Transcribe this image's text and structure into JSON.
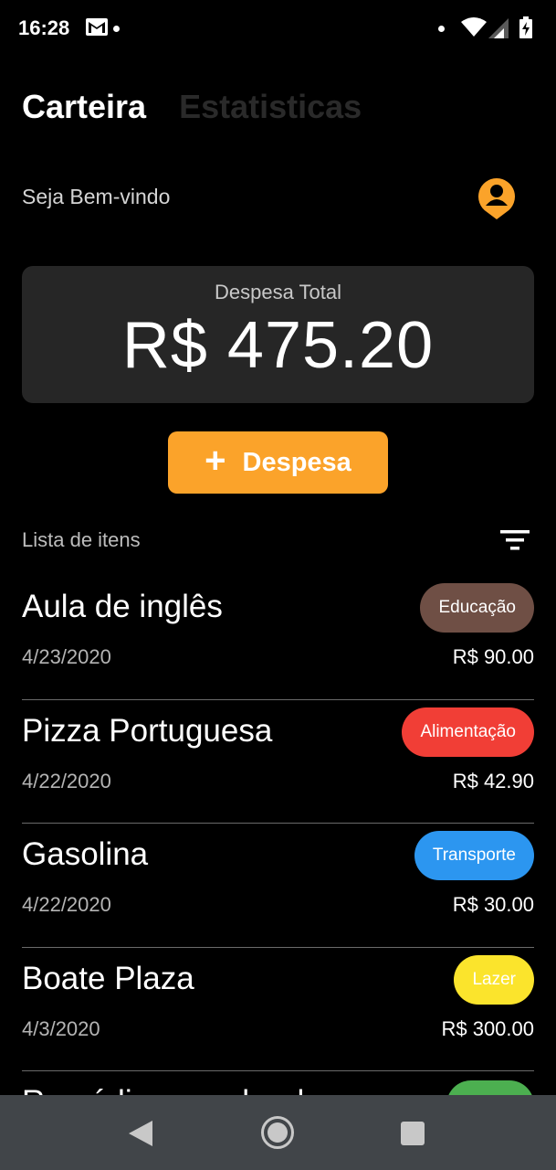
{
  "status_bar": {
    "time": "16:28",
    "icons": [
      "gmail-icon",
      "notification-dot",
      "wifi-icon",
      "signal-icon",
      "battery-icon"
    ]
  },
  "tabs": [
    {
      "label": "Carteira",
      "active": true
    },
    {
      "label": "Estatisticas",
      "active": false
    }
  ],
  "header": {
    "welcome": "Seja Bem-vindo",
    "avatar_icon": "user-pin-icon",
    "accent_color": "#fba32a"
  },
  "summary": {
    "label": "Despesa Total",
    "value": "R$ 475.20"
  },
  "add_button": {
    "icon": "plus-icon",
    "label": "Despesa"
  },
  "list": {
    "title": "Lista de itens",
    "filter_icon": "filter-icon",
    "items": [
      {
        "name": "Aula de inglês",
        "date": "4/23/2020",
        "amount": "R$ 90.00",
        "category": "Educação",
        "color": "#6f4f45"
      },
      {
        "name": "Pizza Portuguesa",
        "date": "4/22/2020",
        "amount": "R$ 42.90",
        "category": "Alimentação",
        "color": "#f13e36"
      },
      {
        "name": "Gasolina",
        "date": "4/22/2020",
        "amount": "R$ 30.00",
        "category": "Transporte",
        "color": "#2c96f0"
      },
      {
        "name": "Boate Plaza",
        "date": "4/3/2020",
        "amount": "R$ 300.00",
        "category": "Lazer",
        "color": "#fbe42c"
      },
      {
        "name": "Remédio para dor de",
        "date": "",
        "amount": "",
        "category": "",
        "color": "#4caf50"
      }
    ]
  },
  "nav_bar": {
    "icons": [
      "back-icon",
      "home-icon",
      "recent-apps-icon"
    ]
  }
}
